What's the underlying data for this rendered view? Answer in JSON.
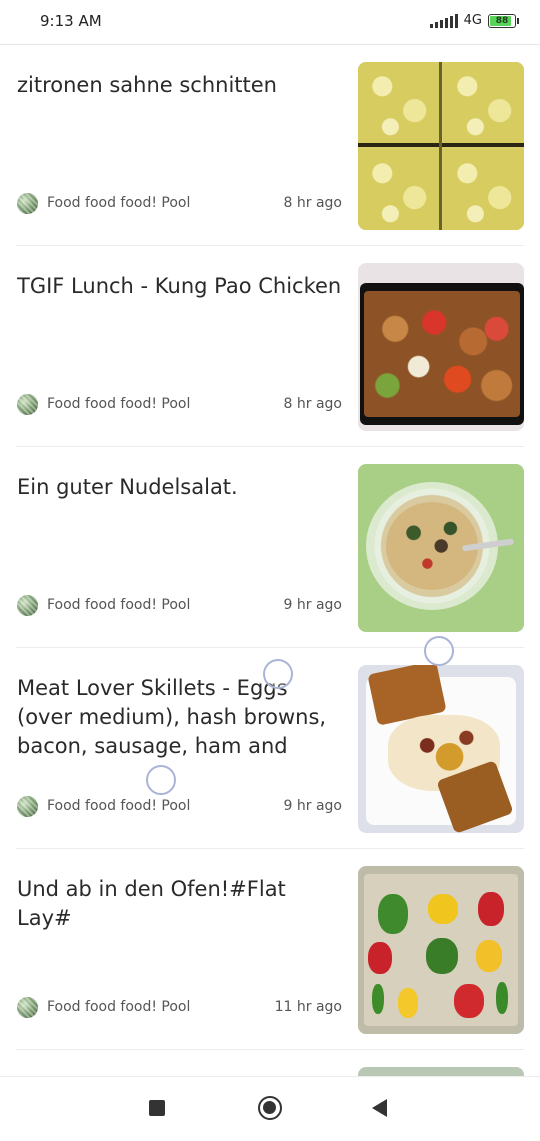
{
  "status_bar": {
    "time": "9:13 AM",
    "network": "4G",
    "battery": "88",
    "battery_color": "#5ad35a"
  },
  "feed": {
    "items": [
      {
        "title": "zitronen sahne schnitten",
        "pool": "Food food food! Pool",
        "age": "8 hr ago",
        "thumb": "lemon-cream-slices-photo"
      },
      {
        "title": "TGIF Lunch - Kung Pao Chicken",
        "pool": "Food food food! Pool",
        "age": "8 hr ago",
        "thumb": "kung-pao-chicken-photo"
      },
      {
        "title": "Ein guter Nudelsalat.",
        "pool": "Food food food! Pool",
        "age": "9 hr ago",
        "thumb": "pasta-salad-photo"
      },
      {
        "title": "Meat Lover Skillets - Eggs (over medium), hash browns, bacon, sausage, ham and cheese with",
        "pool": "Food food food! Pool",
        "age": "9 hr ago",
        "thumb": "breakfast-skillet-photo"
      },
      {
        "title": "Und ab in den Ofen!#Flat Lay#",
        "pool": "Food food food! Pool",
        "age": "11 hr ago",
        "thumb": "peppers-flat-lay-photo"
      }
    ]
  },
  "nav_bar": {
    "icons": [
      "recent-apps-icon",
      "home-icon",
      "back-icon"
    ]
  }
}
